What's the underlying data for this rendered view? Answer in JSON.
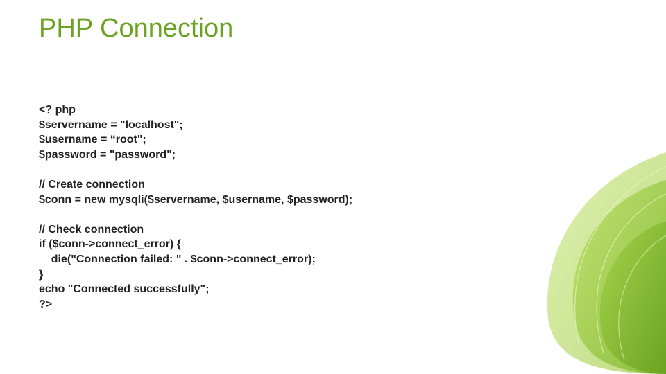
{
  "title": "PHP Connection",
  "code": "<? php\n$servername = \"localhost\";\n$username = “root\";\n$password = \"password\";\n\n// Create connection\n$conn = new mysqli($servername, $username, $password);\n\n// Check connection\nif ($conn->connect_error) {\n    die(\"Connection failed: \" . $conn->connect_error);\n}\necho \"Connected successfully\";\n?>"
}
